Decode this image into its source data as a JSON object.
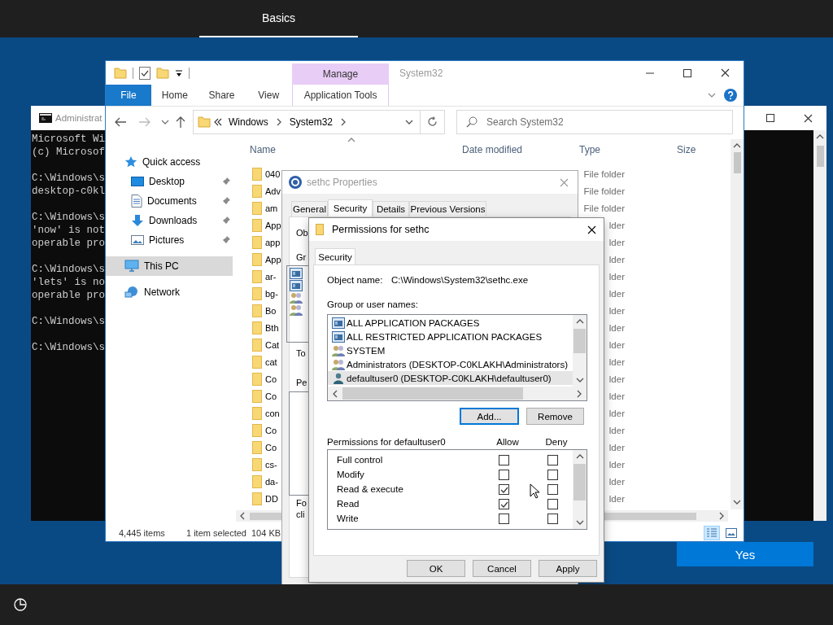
{
  "oobe": {
    "tab": "Basics",
    "yes_button": "Yes"
  },
  "console": {
    "title": "Administrat",
    "blocks": [
      [
        "Microsoft Wi",
        "(c) Microsof"
      ],
      [
        "C:\\Windows\\s",
        "desktop-c0kl"
      ],
      [
        "C:\\Windows\\s",
        "'now' is not",
        "operable pro"
      ],
      [
        "C:\\Windows\\s",
        "'lets' is no",
        "operable pro"
      ],
      [
        "C:\\Windows\\s"
      ],
      [
        "C:\\Windows\\s"
      ]
    ]
  },
  "explorer": {
    "context_tab": "Manage",
    "title": "System32",
    "ribbon_tabs": [
      {
        "label": "File",
        "kind": "file"
      },
      {
        "label": "Home",
        "kind": "tab"
      },
      {
        "label": "Share",
        "kind": "tab"
      },
      {
        "label": "View",
        "kind": "tab"
      },
      {
        "label": "Application Tools",
        "kind": "context"
      }
    ],
    "breadcrumbs": [
      "Windows",
      "System32"
    ],
    "search": {
      "placeholder": "Search System32"
    },
    "nav": [
      {
        "label": "Quick access",
        "kind": "star",
        "selected": false,
        "children": [
          {
            "label": "Desktop",
            "kind": "desktop",
            "pinned": true,
            "selected": false
          },
          {
            "label": "Documents",
            "kind": "documents",
            "pinned": true,
            "selected": false
          },
          {
            "label": "Downloads",
            "kind": "downloads",
            "pinned": true,
            "selected": false
          },
          {
            "label": "Pictures",
            "kind": "pictures",
            "pinned": true,
            "selected": false
          }
        ]
      },
      {
        "label": "This PC",
        "kind": "pc",
        "selected": true
      },
      {
        "label": "Network",
        "kind": "network",
        "selected": false
      }
    ],
    "columns": [
      "Name",
      "Date modified",
      "Type",
      "Size"
    ],
    "rows": [
      {
        "name": "040",
        "type": "File folder"
      },
      {
        "name": "Adv",
        "type": "File folder"
      },
      {
        "name": "am",
        "type": "File folder"
      },
      {
        "name": "App",
        "type": "lder"
      },
      {
        "name": "app",
        "type": "lder"
      },
      {
        "name": "App",
        "type": "lder"
      },
      {
        "name": "ar-",
        "type": "lder"
      },
      {
        "name": "bg-",
        "type": "lder"
      },
      {
        "name": "Bo",
        "type": "lder"
      },
      {
        "name": "Bth",
        "type": "lder"
      },
      {
        "name": "Cat",
        "type": "lder"
      },
      {
        "name": "cat",
        "type": "lder"
      },
      {
        "name": "Co",
        "type": "lder"
      },
      {
        "name": "Co",
        "type": "lder"
      },
      {
        "name": "con",
        "type": "lder"
      },
      {
        "name": "Co",
        "type": "lder"
      },
      {
        "name": "Co",
        "type": "lder"
      },
      {
        "name": "cs-",
        "type": "lder"
      },
      {
        "name": "da-",
        "type": "lder"
      },
      {
        "name": "DD",
        "type": "lder"
      }
    ],
    "status": [
      "4,445 items",
      "1 item selected",
      "104 KB"
    ],
    "view_buttons": [
      {
        "kind": "details",
        "selected": true
      },
      {
        "kind": "preview",
        "selected": false
      }
    ]
  },
  "properties": {
    "title": "sethc Properties",
    "tabs": [
      {
        "label": "General",
        "selected": false
      },
      {
        "label": "Security",
        "selected": true
      },
      {
        "label": "Details",
        "selected": false
      },
      {
        "label": "Previous Versions",
        "selected": false
      }
    ],
    "visible_texts": [
      "Ob",
      "Gr",
      "To",
      "Pe",
      "Fo",
      "cli"
    ]
  },
  "permissions": {
    "title": "Permissions for sethc",
    "tab": "Security",
    "object_label": "Object name:",
    "object_value": "C:\\Windows\\System32\\sethc.exe",
    "group_label": "Group or user names:",
    "principals": [
      {
        "name": "ALL APPLICATION PACKAGES",
        "kind": "package",
        "selected": false
      },
      {
        "name": "ALL RESTRICTED APPLICATION PACKAGES",
        "kind": "package",
        "selected": false
      },
      {
        "name": "SYSTEM",
        "kind": "group",
        "selected": false
      },
      {
        "name": "Administrators (DESKTOP-C0KLAKH\\Administrators)",
        "kind": "group",
        "selected": false
      },
      {
        "name": "defaultuser0 (DESKTOP-C0KLAKH\\defaultuser0)",
        "kind": "user",
        "selected": true
      }
    ],
    "add_button": "Add...",
    "remove_button": "Remove",
    "perm_label": "Permissions for defaultuser0",
    "allow_header": "Allow",
    "deny_header": "Deny",
    "perms": [
      {
        "name": "Full control",
        "allow": false,
        "deny": false
      },
      {
        "name": "Modify",
        "allow": false,
        "deny": false
      },
      {
        "name": "Read & execute",
        "allow": true,
        "deny": false
      },
      {
        "name": "Read",
        "allow": true,
        "deny": false
      },
      {
        "name": "Write",
        "allow": false,
        "deny": false
      }
    ],
    "buttons": [
      "OK",
      "Cancel",
      "Apply"
    ]
  }
}
